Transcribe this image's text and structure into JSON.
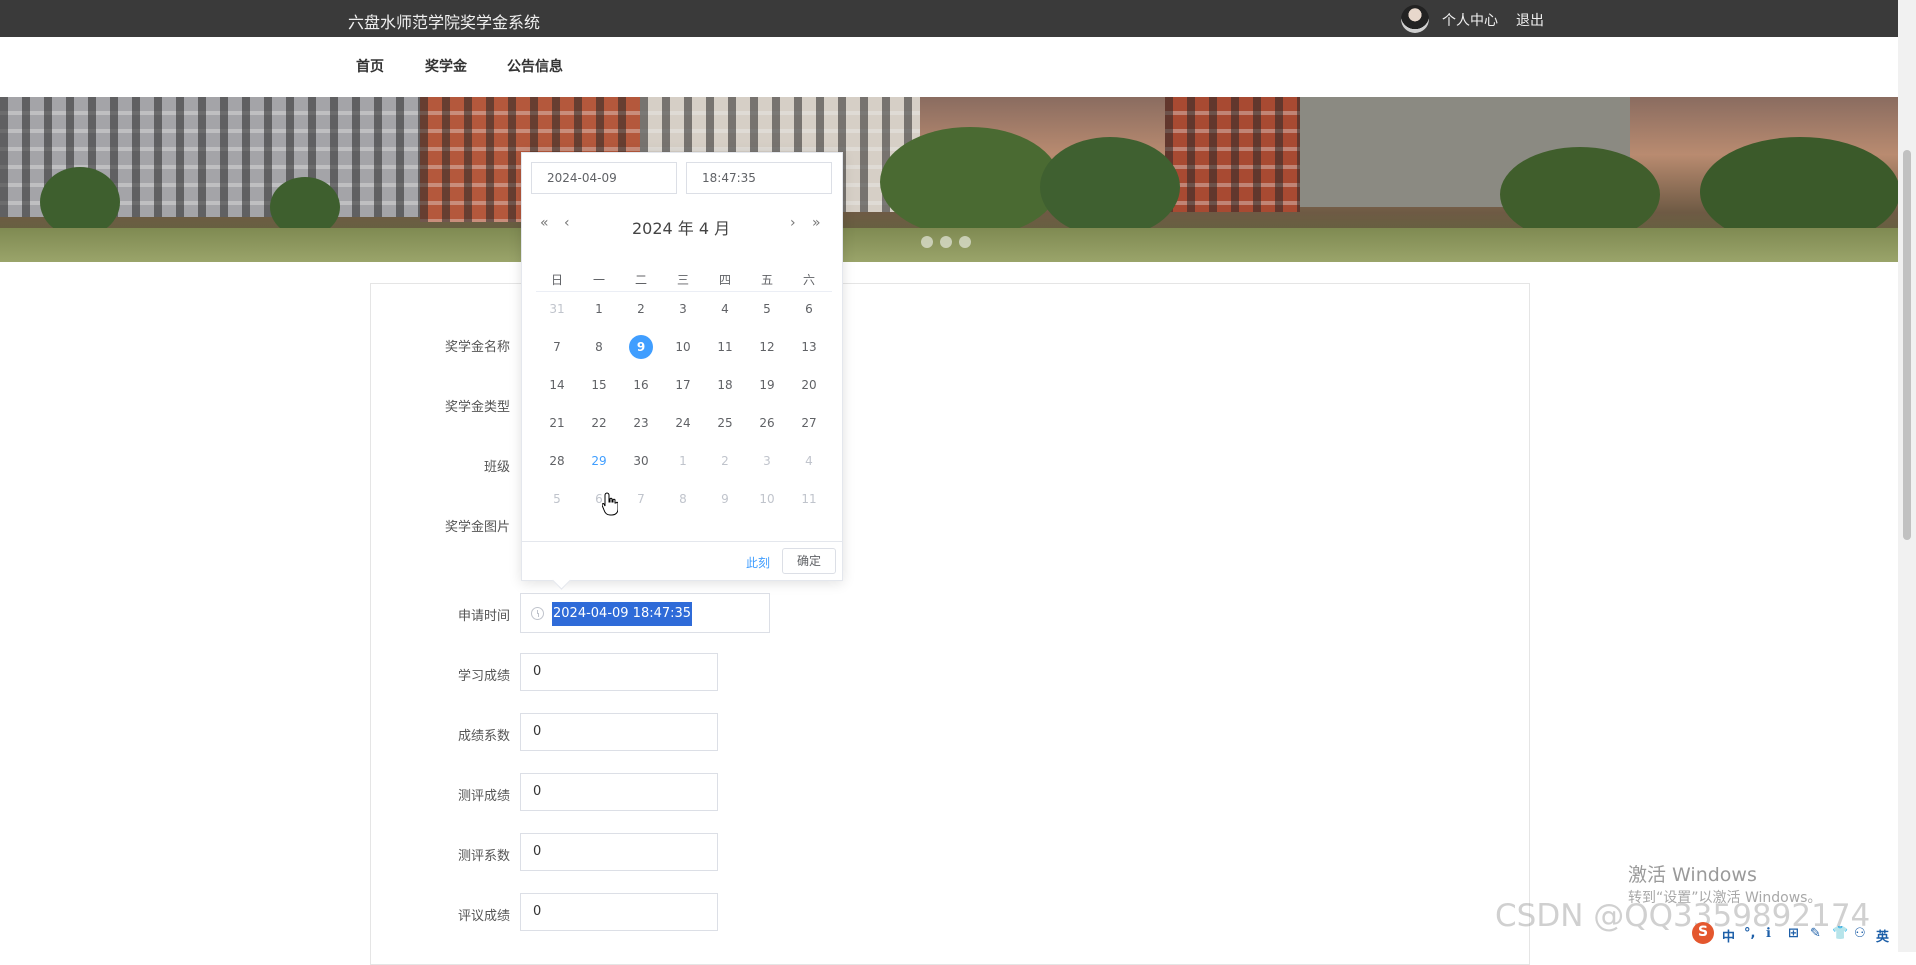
{
  "header": {
    "site_title": "六盘水师范学院奖学金系统",
    "user_center": "个人中心",
    "logout": "退出"
  },
  "nav": {
    "items": [
      {
        "label": "首页"
      },
      {
        "label": "奖学金"
      },
      {
        "label": "公告信息"
      }
    ]
  },
  "banner": {
    "carousel_count": 3
  },
  "form": {
    "labels": {
      "name": "奖学金名称",
      "type": "奖学金类型",
      "class": "班级",
      "image": "奖学金图片",
      "apply_time": "申请时间",
      "study_score": "学习成绩",
      "score_coefficient": "成绩系数",
      "eval_score": "测评成绩",
      "eval_coefficient": "测评系数",
      "review_score": "评议成绩"
    },
    "apply_time_value": "2024-04-09 18:47:35",
    "values": {
      "study_score": "0",
      "score_coefficient": "0",
      "eval_score": "0",
      "eval_coefficient": "0",
      "review_score": "0"
    }
  },
  "picker": {
    "date_field": "2024-04-09",
    "time_field": "18:47:35",
    "title": "2024 年  4 月",
    "nav": {
      "prev_year": "«",
      "prev_month": "‹",
      "next_month": "›",
      "next_year": "»"
    },
    "weekdays": [
      "日",
      "一",
      "二",
      "三",
      "四",
      "五",
      "六"
    ],
    "weeks": [
      [
        {
          "d": "31",
          "o": true
        },
        {
          "d": "1"
        },
        {
          "d": "2"
        },
        {
          "d": "3"
        },
        {
          "d": "4"
        },
        {
          "d": "5"
        },
        {
          "d": "6"
        }
      ],
      [
        {
          "d": "7"
        },
        {
          "d": "8"
        },
        {
          "d": "9",
          "sel": true
        },
        {
          "d": "10"
        },
        {
          "d": "11"
        },
        {
          "d": "12"
        },
        {
          "d": "13"
        }
      ],
      [
        {
          "d": "14"
        },
        {
          "d": "15"
        },
        {
          "d": "16"
        },
        {
          "d": "17"
        },
        {
          "d": "18"
        },
        {
          "d": "19"
        },
        {
          "d": "20"
        }
      ],
      [
        {
          "d": "21"
        },
        {
          "d": "22"
        },
        {
          "d": "23"
        },
        {
          "d": "24"
        },
        {
          "d": "25"
        },
        {
          "d": "26"
        },
        {
          "d": "27"
        }
      ],
      [
        {
          "d": "28"
        },
        {
          "d": "29",
          "today": true
        },
        {
          "d": "30"
        },
        {
          "d": "1",
          "o": true
        },
        {
          "d": "2",
          "o": true
        },
        {
          "d": "3",
          "o": true
        },
        {
          "d": "4",
          "o": true
        }
      ],
      [
        {
          "d": "5",
          "o": true
        },
        {
          "d": "6",
          "o": true
        },
        {
          "d": "7",
          "o": true
        },
        {
          "d": "8",
          "o": true
        },
        {
          "d": "9",
          "o": true
        },
        {
          "d": "10",
          "o": true
        },
        {
          "d": "11",
          "o": true
        }
      ]
    ],
    "now_label": "此刻",
    "ok_label": "确定"
  },
  "watermark": {
    "activate": "激活 Windows",
    "activate_sub": "转到“设置”以激活 Windows。",
    "csdn": "CSDN @QQ3359892174"
  },
  "tray": {
    "items": [
      "中",
      "°,",
      "ℹ",
      "⊞",
      "✎",
      "👕",
      "⚇",
      "英"
    ]
  },
  "colors": {
    "accent": "#409eff",
    "topbar": "#3a3a3a",
    "selection": "#2f6bd8"
  }
}
